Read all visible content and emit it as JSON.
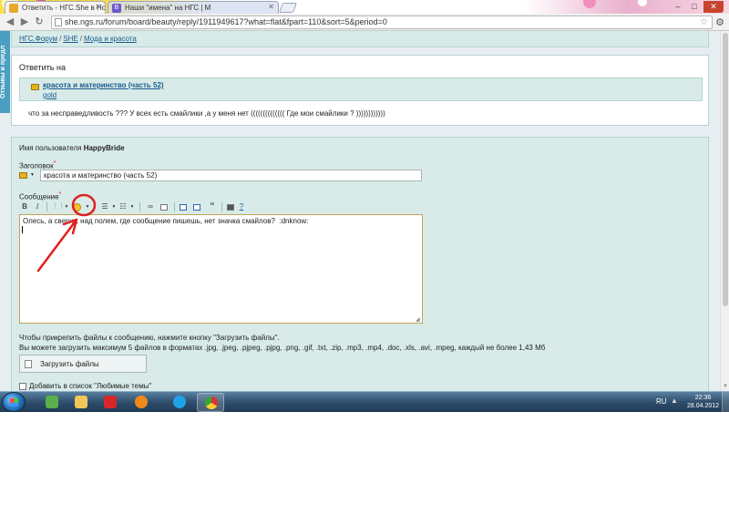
{
  "browser": {
    "tabs": [
      {
        "title": "Ответить - НГС.She в Ново",
        "active": true
      },
      {
        "title": "Наши \"имена\" на НГС | М",
        "active": false
      }
    ],
    "url": "she.ngs.ru/forum/board/beauty/reply/1911949617?what=flat&fpart=110&sort=5&period=0",
    "window_buttons": {
      "minimize": "–",
      "maximize": "□",
      "close": "✕"
    }
  },
  "sidebar_tab": "Отзывы и предл",
  "breadcrumbs": [
    "НГС.Форум",
    "SHE",
    "Мода и красота"
  ],
  "reply": {
    "header": "Ответить на",
    "quote_title": "красота и материнство (часть 52)",
    "quote_author": "gold",
    "quote_text": "что за несправедливость ??? У всех есть смайлики ,а у меня нет (((((((((((((( Где мои смайлики ? ))))))))))))"
  },
  "form": {
    "user_label": "Имя пользователя",
    "username": "HappyBride",
    "subject_label": "Заголовок",
    "subject_value": "красота и материнство (часть 52)",
    "message_label": "Сообщение",
    "required_mark": "*",
    "toolbar": {
      "bold": "B",
      "italic": "I",
      "quote": "“",
      "help": "?"
    },
    "message_text": "Олесь, а сверху, над полем, где сообщение пишешь, нет значка смайлов?  :dnknow:",
    "attach_info_1": "Чтобы прикрепить файлы к сообщению, нажмите кнопку \"Загрузить файлы\".",
    "attach_info_2": "Вы можете загрузить максимум 5 файлов в форматах .jpg, .jpeg, .pjpeg, .pjpg, .png, .gif, .txt, .zip, .mp3, .mp4, .doc, .xls, .avi, .mpeg, каждый не более 1,43 Мб",
    "upload_button": "Загрузить файлы",
    "favorites_checkbox": "Добавить в список \"Любимые темы\""
  },
  "annotation": {
    "color": "#e02020",
    "target": "smiley-button"
  },
  "taskbar": {
    "language": "RU",
    "time": "22:36",
    "date": "28.04.2012",
    "apps": [
      "windows-explorer-icon",
      "media-center-icon",
      "pdf-reader-icon",
      "firefox-icon",
      "skype-icon",
      "chrome-icon"
    ]
  }
}
